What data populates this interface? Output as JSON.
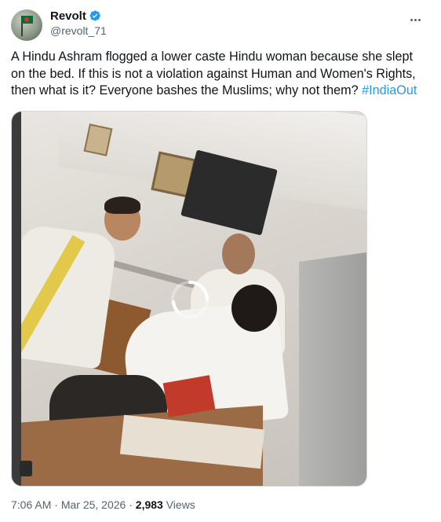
{
  "author": {
    "display_name": "Revolt",
    "handle": "@revolt_71",
    "verified": true,
    "accent_color": "#1d9bf0"
  },
  "tweet": {
    "text": "A Hindu Ashram flogged a lower caste Hindu woman because she slept on the bed. If this is not a violation against Human and Women's Rights, then what is it? Everyone bashes the Muslims; why not them? ",
    "hashtag": "#IndiaOut"
  },
  "media": {
    "type": "video",
    "state": "loading"
  },
  "meta": {
    "time": "7:06 AM",
    "separator": " · ",
    "date": "Mar 25, 2026",
    "views_count": "2,983",
    "views_label": " Views"
  },
  "icons": {
    "verified": "verified-badge-icon",
    "more": "more-options-icon",
    "loading": "loading-spinner-icon"
  }
}
